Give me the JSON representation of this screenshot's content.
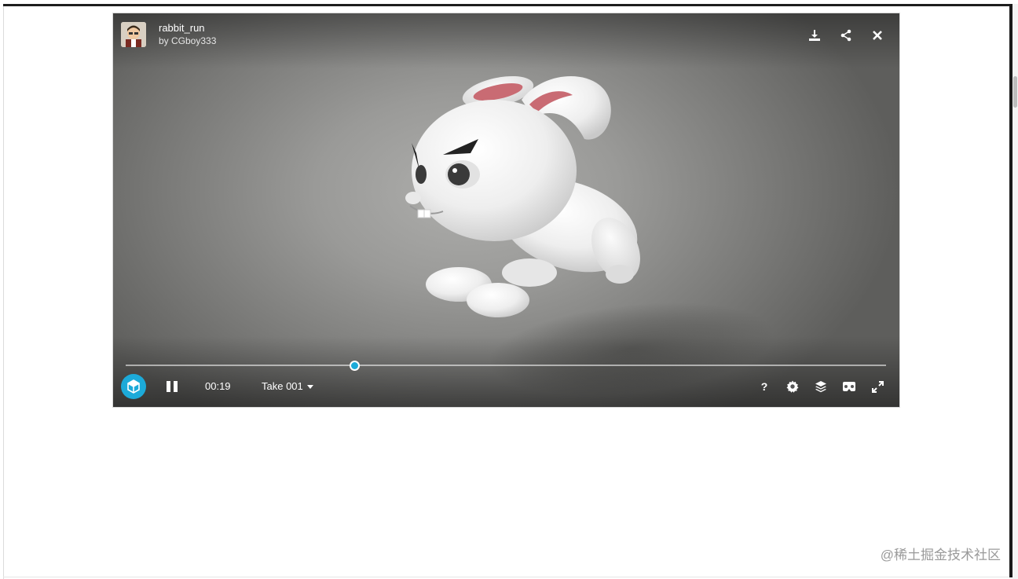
{
  "model": {
    "title": "rabbit_run",
    "author": "by CGboy333"
  },
  "header_icons": [
    "download-icon",
    "share-icon",
    "close-icon"
  ],
  "player": {
    "time": "00:19",
    "take": "Take 001",
    "progress": 0.301
  },
  "control_icons": [
    "help-icon",
    "settings-icon",
    "layers-icon",
    "vr-icon",
    "fullscreen-icon"
  ],
  "watermark": "@稀土掘金技术社区",
  "colors": {
    "accent": "#1caad9",
    "viewer_bg": "#9a9a98"
  }
}
